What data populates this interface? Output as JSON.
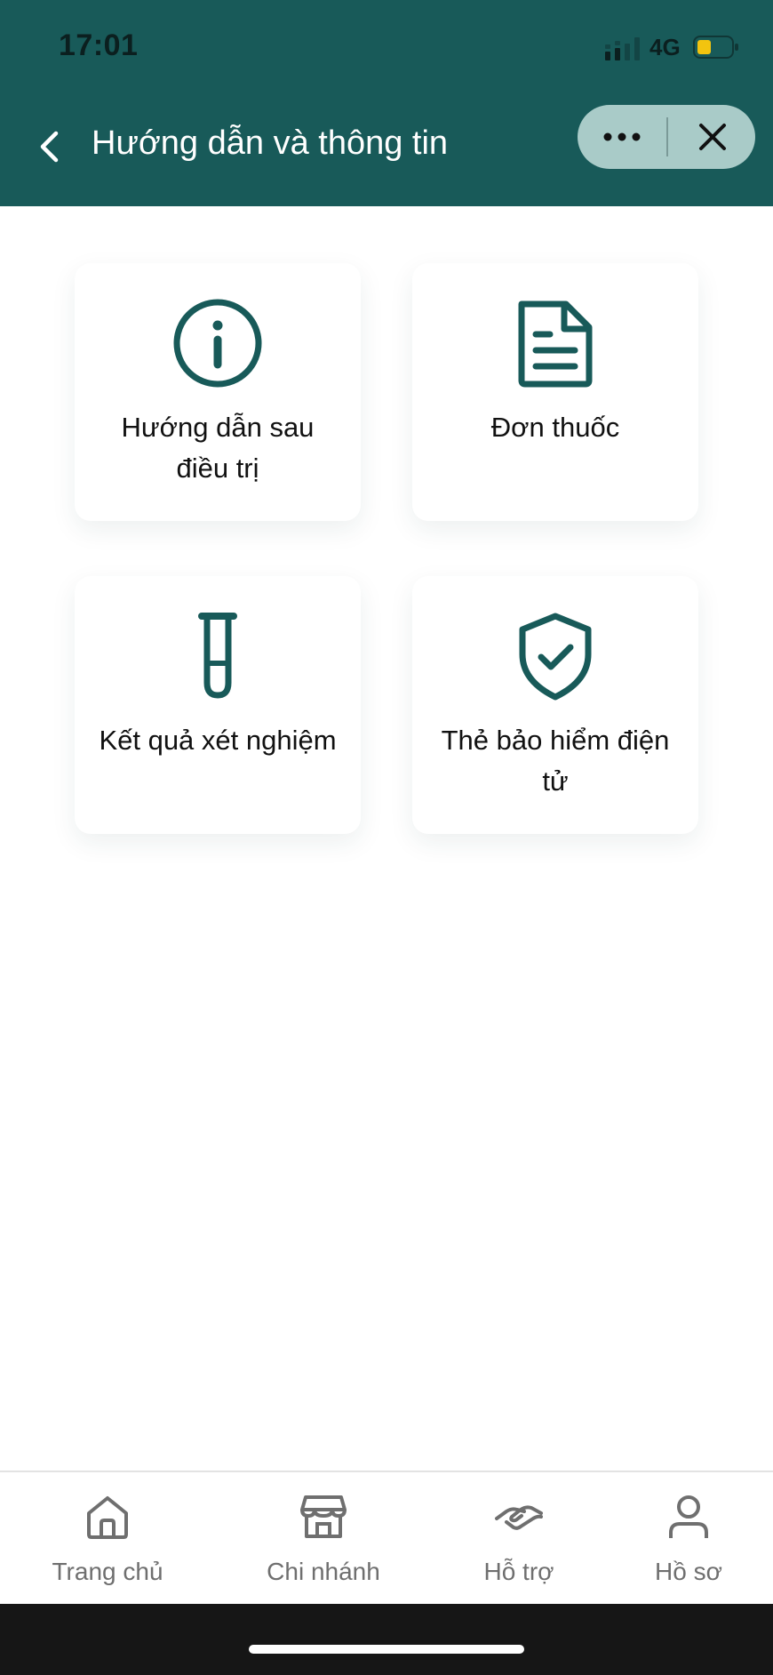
{
  "status_bar": {
    "time": "17:01",
    "network": "4G",
    "signal_icon": "signal-icon",
    "battery_icon": "battery-icon"
  },
  "header": {
    "title": "Hướng dẫn và thông tin",
    "back_icon": "chevron-left-icon",
    "more_icon": "more-dots-icon",
    "close_icon": "close-icon"
  },
  "cards": [
    {
      "label": "Hướng dẫn sau điều trị",
      "icon": "info-icon"
    },
    {
      "label": "Đơn thuốc",
      "icon": "document-icon"
    },
    {
      "label": "Kết quả xét nghiệm",
      "icon": "test-tube-icon"
    },
    {
      "label": "Thẻ bảo hiểm điện tử",
      "icon": "shield-check-icon"
    }
  ],
  "bottom_nav": [
    {
      "label": "Trang chủ",
      "icon": "home-icon"
    },
    {
      "label": "Chi nhánh",
      "icon": "store-icon"
    },
    {
      "label": "Hỗ trợ",
      "icon": "handshake-icon"
    },
    {
      "label": "Hồ sơ",
      "icon": "user-icon"
    }
  ],
  "colors": {
    "brand": "#185a59",
    "capsule": "#a9cbc8",
    "nav_text": "#6f6f6f",
    "battery_level": "#f2c40f"
  }
}
